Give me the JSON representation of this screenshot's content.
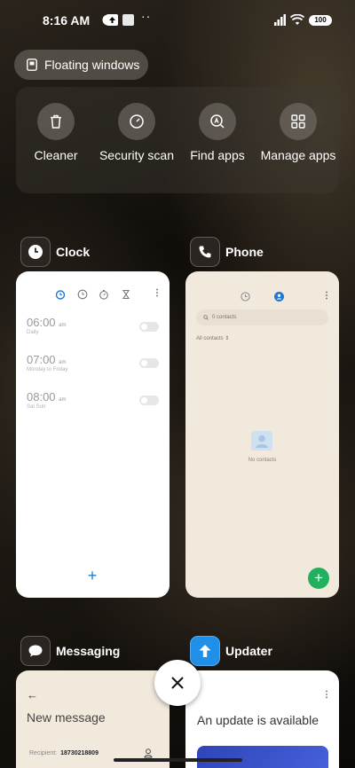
{
  "status_bar": {
    "time": "8:16 AM",
    "battery": "100"
  },
  "floating_windows": {
    "label": "Floating windows"
  },
  "quick_actions": [
    {
      "label": "Cleaner",
      "icon": "trash-icon"
    },
    {
      "label": "Security scan",
      "icon": "shield-check-icon"
    },
    {
      "label": "Find apps",
      "icon": "search-apps-icon"
    },
    {
      "label": "Manage apps",
      "icon": "grid-icon"
    }
  ],
  "apps": {
    "clock": {
      "name": "Clock",
      "alarms": [
        {
          "time": "06:00",
          "ampm": "am",
          "repeat": "Daily"
        },
        {
          "time": "07:00",
          "ampm": "am",
          "repeat": "Monday to Friday"
        },
        {
          "time": "08:00",
          "ampm": "am",
          "repeat": "Sat Sun"
        }
      ]
    },
    "phone": {
      "name": "Phone",
      "search_placeholder": "0 contacts",
      "filter": "All contacts",
      "empty": "No contacts"
    },
    "messaging": {
      "name": "Messaging",
      "title": "New message",
      "recipient_label": "Recipient:",
      "recipient_value": "18730218809"
    },
    "updater": {
      "name": "Updater",
      "title": "An update is available"
    }
  },
  "colors": {
    "accent_blue": "#1e78d6",
    "green_fab": "#21b05e"
  }
}
